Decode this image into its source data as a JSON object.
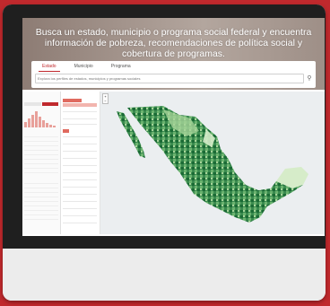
{
  "hero": {
    "title": "Busca un estado, municipio o programa social federal y encuentra información de pobreza, recomendaciones de política social y cobertura de programas."
  },
  "tabs": [
    {
      "label": "Estado",
      "active": true
    },
    {
      "label": "Municipio",
      "active": false
    },
    {
      "label": "Programa",
      "active": false
    }
  ],
  "search": {
    "placeholder": "Explora los perfiles de estados, municipios y programas sociales",
    "icon": "search-icon"
  },
  "colors": {
    "brand": "#c0292d",
    "map_dark": "#1b6b35",
    "map_light": "#d6ecc9"
  }
}
